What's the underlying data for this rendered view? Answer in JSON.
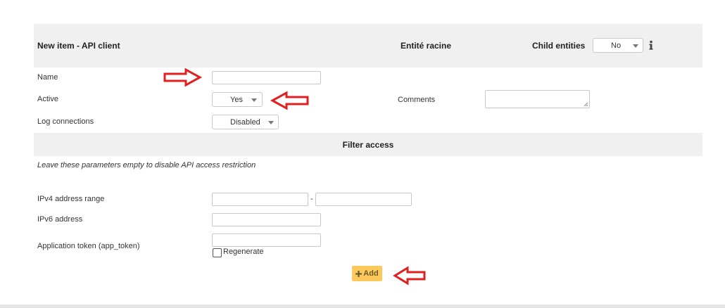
{
  "header": {
    "title": "New item - API client",
    "entity": "Entité racine",
    "child_entities_label": "Child entities",
    "child_entities_value": "No"
  },
  "form": {
    "name_label": "Name",
    "active_label": "Active",
    "active_value": "Yes",
    "comments_label": "Comments",
    "log_label": "Log connections",
    "log_value": "Disabled"
  },
  "filter": {
    "title": "Filter access",
    "note": "Leave these parameters empty to disable API access restriction",
    "ipv4_label": "IPv4 address range",
    "range_separator": "-",
    "ipv6_label": "IPv6 address",
    "token_label": "Application token (app_token)",
    "regenerate_label": "Regenerate"
  },
  "actions": {
    "add_label": "Add"
  },
  "icons": {
    "info": "info-icon",
    "plus": "plus-icon",
    "annotation": "red-arrow-icon"
  },
  "colors": {
    "header_band": "#f0f0f0",
    "add_button": "#fec95c",
    "annotation_arrow": "#e02020"
  }
}
